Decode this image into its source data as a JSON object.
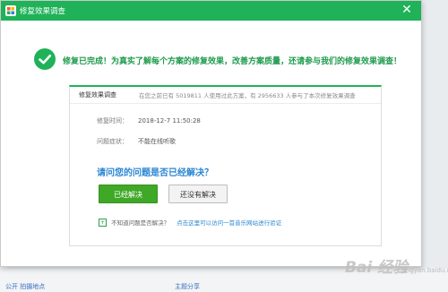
{
  "window": {
    "title": "修复效果调查",
    "close_glyph": "✕"
  },
  "headline": "修复已完成！为真实了解每个方案的修复效果，改善方案质量，还请参与我们的修复效果调查！",
  "card": {
    "title": "修复效果调查",
    "stats": "在您之前已有 5019811 人使用过此方案，有 2956633 人参与了本次修复效果调查",
    "time_label": "修复时间：",
    "time_value": "2018-12-7 11:50:28",
    "symptom_label": "问题症状：",
    "symptom_value": "不能在线听歌",
    "question": "请问您的问题是否已经解决？",
    "solved_label": "已经解决",
    "unsolved_label": "还没有解决",
    "footer_text": "不知道问题是否解决？",
    "footer_link": "点击这里可以访问一首音乐网站进行验证"
  },
  "background": {
    "bottom_link_1": "公开 拍摄地点",
    "bottom_link_2": "主题分享"
  },
  "watermark": {
    "main": "Bai 经验",
    "sub": "jingyan.baidu.com"
  },
  "colors": {
    "accent_green": "#1fb259",
    "button_green": "#40a827",
    "question_blue": "#2a86d1"
  },
  "icons": {
    "app": "app-grid-icon",
    "success": "check-circle-icon",
    "footer": "plus-square-icon"
  }
}
